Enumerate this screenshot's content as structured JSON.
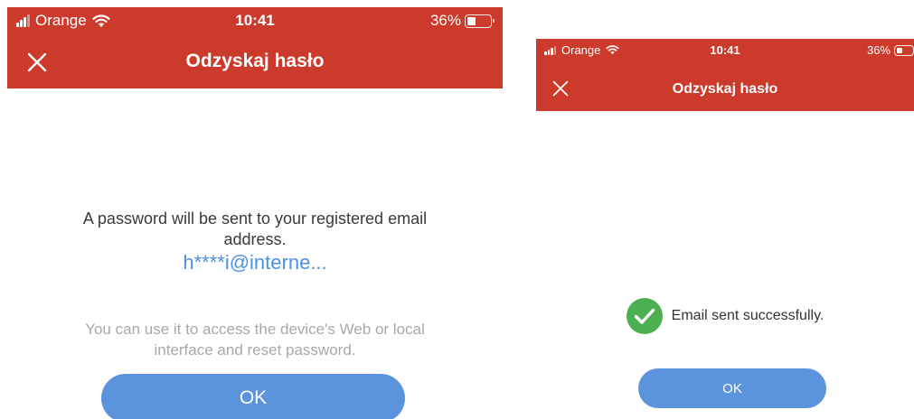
{
  "colors": {
    "header_bg": "#cc3a2b",
    "link_blue": "#4a90e2",
    "button_blue": "#5b93dc",
    "success_green": "#4caf50"
  },
  "screens": [
    {
      "status_bar": {
        "carrier": "Orange",
        "time": "10:41",
        "battery": "36%",
        "battery_level": 0.36
      },
      "nav": {
        "title": "Odzyskaj hasło",
        "close_icon": "close-icon"
      },
      "message": {
        "main": "A password will be sent to your registered email address.",
        "email": "h****i@interne...",
        "sub": "You can use it to access the device's Web or local interface and reset password."
      },
      "ok_label": "OK"
    },
    {
      "status_bar": {
        "carrier": "Orange",
        "time": "10:41",
        "battery": "36%",
        "battery_level": 0.36
      },
      "nav": {
        "title": "Odzyskaj hasło",
        "close_icon": "close-icon"
      },
      "success": {
        "icon": "check-circle-icon",
        "text": "Email sent successfully."
      },
      "ok_label": "OK"
    }
  ]
}
